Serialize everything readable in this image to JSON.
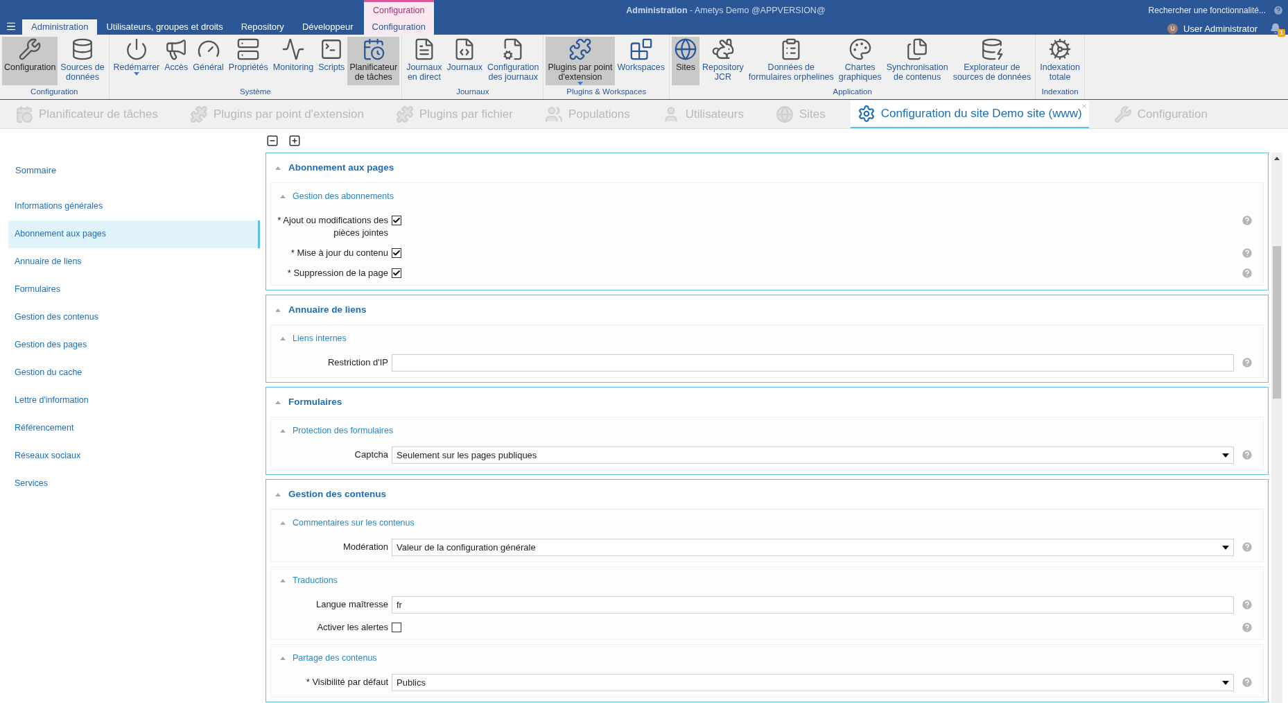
{
  "header": {
    "title": "**Administration** - Ametys Demo @APPVERSION@",
    "search_placeholder": "Rechercher une fonctionnalité...",
    "user": {
      "initial": "U",
      "name": "User Administrator"
    },
    "notifications": "1"
  },
  "menu_tabs": [
    {
      "label": "Administration",
      "selected": true
    },
    {
      "label": "Utilisateurs, groupes et droits",
      "selected": false
    },
    {
      "label": "Repository",
      "selected": false
    },
    {
      "label": "Développeur",
      "selected": false
    }
  ],
  "contextual_tab": {
    "group": "Configuration",
    "label": "Configuration",
    "selected": false
  },
  "ribbon": [
    {
      "label": "Configuration",
      "items": [
        {
          "lines": [
            "Configuration"
          ],
          "selected": true,
          "dropdown": false
        },
        {
          "lines": [
            "Sources de",
            "données"
          ],
          "selected": false,
          "dropdown": false
        }
      ]
    },
    {
      "label": "Système",
      "items": [
        {
          "lines": [
            "Redémarrer"
          ],
          "selected": false,
          "dropdown": true
        },
        {
          "lines": [
            "Accès"
          ],
          "selected": false,
          "dropdown": false
        },
        {
          "lines": [
            "Général"
          ],
          "selected": false,
          "dropdown": false
        },
        {
          "lines": [
            "Propriétés"
          ],
          "selected": false,
          "dropdown": false
        },
        {
          "lines": [
            "Monitoring"
          ],
          "selected": false,
          "dropdown": false
        },
        {
          "lines": [
            "Scripts"
          ],
          "selected": false,
          "dropdown": false
        },
        {
          "lines": [
            "Planificateur",
            "de tâches"
          ],
          "selected": true,
          "dropdown": false
        }
      ]
    },
    {
      "label": "Journaux",
      "items": [
        {
          "lines": [
            "Journaux",
            "en direct"
          ],
          "selected": false,
          "dropdown": false
        },
        {
          "lines": [
            "Journaux"
          ],
          "selected": false,
          "dropdown": false
        },
        {
          "lines": [
            "Configuration",
            "des journaux"
          ],
          "selected": false,
          "dropdown": false
        }
      ]
    },
    {
      "label": "Plugins & Workspaces",
      "items": [
        {
          "lines": [
            "Plugins par point",
            "d'extension"
          ],
          "selected": true,
          "dropdown": true
        },
        {
          "lines": [
            "Workspaces"
          ],
          "selected": false,
          "dropdown": false
        }
      ]
    },
    {
      "label": "Application",
      "items": [
        {
          "lines": [
            "Sites"
          ],
          "selected": true,
          "dropdown": false
        },
        {
          "lines": [
            "Repository",
            "JCR"
          ],
          "selected": false,
          "dropdown": false
        },
        {
          "lines": [
            "Données de",
            "formulaires orphelines"
          ],
          "selected": false,
          "dropdown": false
        },
        {
          "lines": [
            "Chartes",
            "graphiques"
          ],
          "selected": false,
          "dropdown": false
        },
        {
          "lines": [
            "Synchronisation",
            "de contenus"
          ],
          "selected": false,
          "dropdown": false
        },
        {
          "lines": [
            "Explorateur de",
            "sources de données"
          ],
          "selected": false,
          "dropdown": false
        }
      ]
    },
    {
      "label": "Indexation",
      "items": [
        {
          "lines": [
            "Indexation",
            "totale"
          ],
          "selected": false,
          "dropdown": false
        }
      ]
    }
  ],
  "doc_tabs": [
    {
      "label": "Planificateur de tâches",
      "selected": false,
      "closable": false
    },
    {
      "label": "Plugins par point d'extension",
      "selected": false,
      "closable": false
    },
    {
      "label": "Plugins par fichier",
      "selected": false,
      "closable": false
    },
    {
      "label": "Populations",
      "selected": false,
      "closable": false
    },
    {
      "label": "Utilisateurs",
      "selected": false,
      "closable": false
    },
    {
      "label": "Sites",
      "selected": false,
      "closable": false
    },
    {
      "label": "Configuration du site Demo site (www)",
      "selected": true,
      "closable": true
    },
    {
      "label": "Configuration",
      "selected": false,
      "closable": false
    }
  ],
  "sidebar": {
    "title": "Sommaire",
    "items": [
      {
        "label": "Informations générales",
        "selected": false
      },
      {
        "label": "Abonnement aux pages",
        "selected": true
      },
      {
        "label": "Annuaire de liens",
        "selected": false
      },
      {
        "label": "Formulaires",
        "selected": false
      },
      {
        "label": "Gestion des contenus",
        "selected": false
      },
      {
        "label": "Gestion des pages",
        "selected": false
      },
      {
        "label": "Gestion du cache",
        "selected": false
      },
      {
        "label": "Lettre d'information",
        "selected": false
      },
      {
        "label": "Référencement",
        "selected": false
      },
      {
        "label": "Réseaux sociaux",
        "selected": false
      },
      {
        "label": "Services",
        "selected": false
      }
    ]
  },
  "sections": [
    {
      "title": "Abonnement aux pages",
      "expanded": true,
      "groups": [
        {
          "title": "Gestion des abonnements",
          "expanded": true,
          "fields": [
            {
              "kind": "checkbox",
              "label": "* Ajout ou modifications des pièces jointes",
              "checked": true
            },
            {
              "kind": "checkbox",
              "label": "* Mise à jour du contenu",
              "checked": true
            },
            {
              "kind": "checkbox",
              "label": "* Suppression de la page",
              "checked": true
            }
          ]
        }
      ]
    },
    {
      "title": "Annuaire de liens",
      "expanded": true,
      "groups": [
        {
          "title": "Liens internes",
          "expanded": true,
          "fields": [
            {
              "kind": "text",
              "label": "Restriction d'IP"
            }
          ]
        }
      ]
    },
    {
      "title": "Formulaires",
      "expanded": true,
      "groups": [
        {
          "title": "Protection des formulaires",
          "expanded": true,
          "fields": [
            {
              "kind": "select",
              "label": "Captcha",
              "value": "Seulement sur les pages publiques"
            }
          ]
        }
      ]
    },
    {
      "title": "Gestion des contenus",
      "expanded": true,
      "groups": [
        {
          "title": "Commentaires sur les contenus",
          "expanded": true,
          "fields": [
            {
              "kind": "select",
              "label": "Modération",
              "value": "Valeur de la configuration générale"
            }
          ]
        },
        {
          "title": "Traductions",
          "expanded": true,
          "fields": [
            {
              "kind": "text",
              "label": "Langue maîtresse",
              "value": "fr"
            },
            {
              "kind": "checkbox",
              "label": "Activer les alertes",
              "checked": false
            }
          ]
        },
        {
          "title": "Partage des contenus",
          "expanded": true,
          "fields": [
            {
              "kind": "select",
              "label": "* Visibilité par défaut",
              "value": "Publics"
            }
          ]
        }
      ]
    }
  ]
}
